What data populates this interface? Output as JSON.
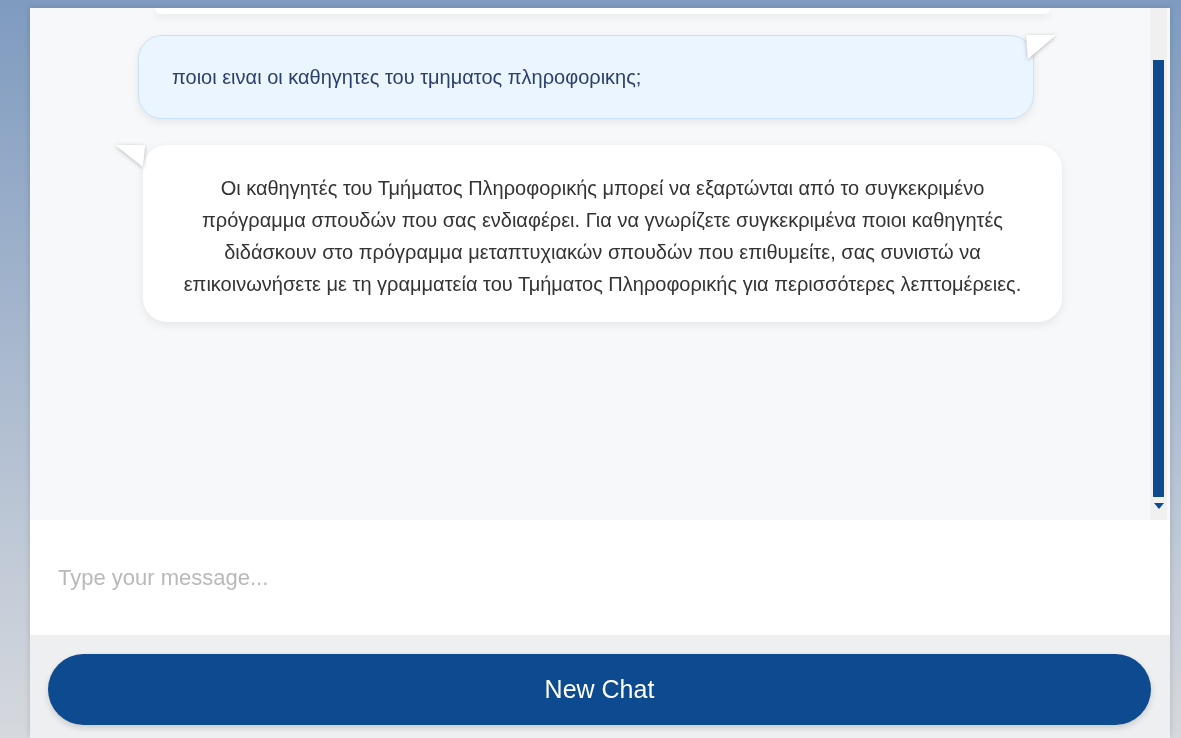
{
  "messages": [
    {
      "kind": "partial"
    },
    {
      "kind": "user",
      "text": "ποιοι ειναι οι καθηγητες του τμηματος πληροφορικης;"
    },
    {
      "kind": "bot",
      "text": "Οι καθηγητές του Τμήματος Πληροφορικής μπορεί να εξαρτώνται από το συγκεκριμένο πρόγραμμα σπουδών που σας ενδιαφέρει. Για να γνωρίζετε συγκεκριμένα ποιοι καθηγητές διδάσκουν στο πρόγραμμα μεταπτυχιακών σπουδών που επιθυμείτε, σας συνιστώ να επικοινωνήσετε με τη γραμματεία του Τμήματος Πληροφορικής για περισσότερες λεπτομέρειες."
    }
  ],
  "input": {
    "placeholder": "Type your message..."
  },
  "new_chat_button": {
    "label": "New Chat"
  }
}
